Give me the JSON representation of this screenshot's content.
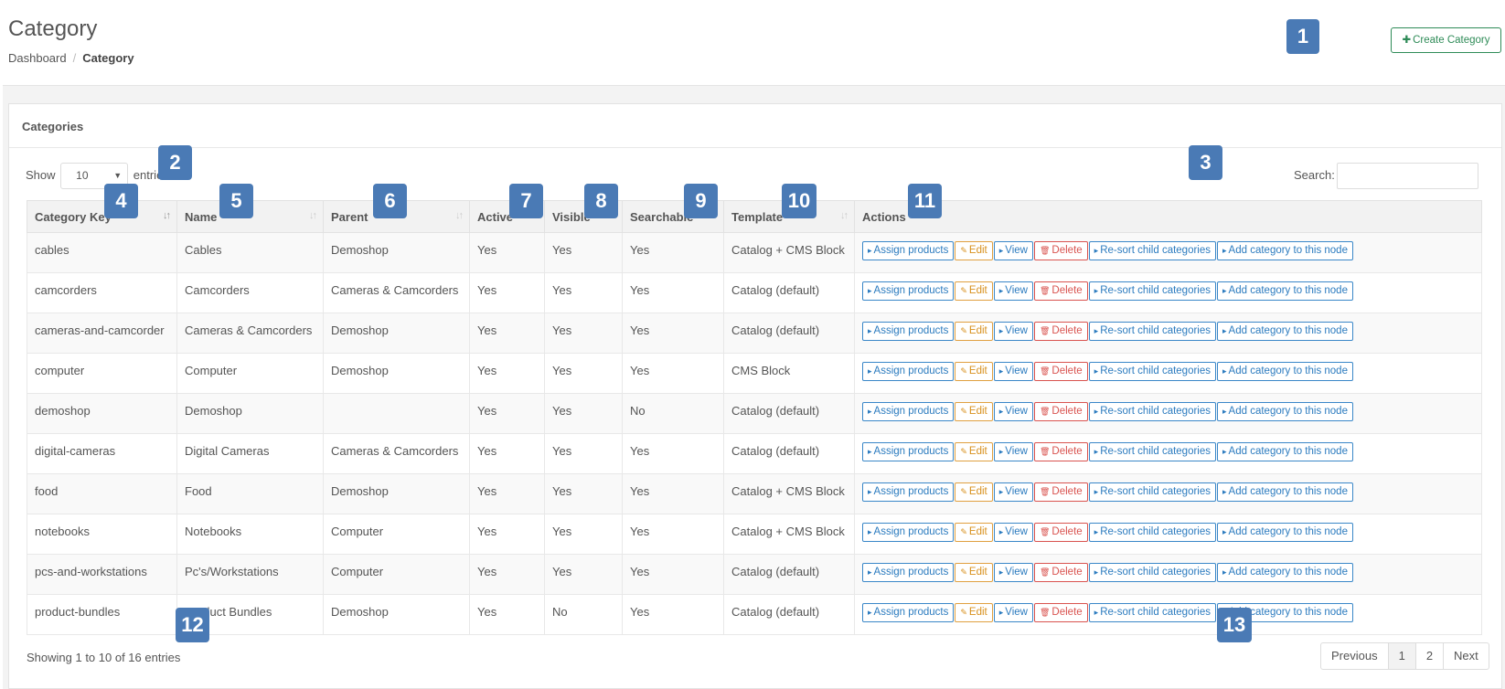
{
  "page": {
    "title": "Category",
    "breadcrumb": [
      "Dashboard",
      "Category"
    ],
    "create_button": "Create Category"
  },
  "panel": {
    "heading": "Categories",
    "show_label": "Show",
    "entries_label": "entries",
    "page_size": "10",
    "search_label": "Search:",
    "search_value": ""
  },
  "table": {
    "columns": [
      "Category Key",
      "Name",
      "Parent",
      "Active",
      "Visible",
      "Searchable",
      "Template",
      "Actions"
    ],
    "rows": [
      [
        "cables",
        "Cables",
        "Demoshop",
        "Yes",
        "Yes",
        "Yes",
        "Catalog + CMS Block"
      ],
      [
        "camcorders",
        "Camcorders",
        "Cameras & Camcorders",
        "Yes",
        "Yes",
        "Yes",
        "Catalog (default)"
      ],
      [
        "cameras-and-camcorder",
        "Cameras & Camcorders",
        "Demoshop",
        "Yes",
        "Yes",
        "Yes",
        "Catalog (default)"
      ],
      [
        "computer",
        "Computer",
        "Demoshop",
        "Yes",
        "Yes",
        "Yes",
        "CMS Block"
      ],
      [
        "demoshop",
        "Demoshop",
        "",
        "Yes",
        "Yes",
        "No",
        "Catalog (default)"
      ],
      [
        "digital-cameras",
        "Digital Cameras",
        "Cameras & Camcorders",
        "Yes",
        "Yes",
        "Yes",
        "Catalog (default)"
      ],
      [
        "food",
        "Food",
        "Demoshop",
        "Yes",
        "Yes",
        "Yes",
        "Catalog + CMS Block"
      ],
      [
        "notebooks",
        "Notebooks",
        "Computer",
        "Yes",
        "Yes",
        "Yes",
        "Catalog + CMS Block"
      ],
      [
        "pcs-and-workstations",
        "Pc's/Workstations",
        "Computer",
        "Yes",
        "Yes",
        "Yes",
        "Catalog (default)"
      ],
      [
        "product-bundles",
        "Product Bundles",
        "Demoshop",
        "Yes",
        "No",
        "Yes",
        "Catalog (default)"
      ]
    ],
    "actions": [
      "Assign products",
      "Edit",
      "View",
      "Delete",
      "Re-sort child categories",
      "Add category to this node"
    ]
  },
  "footer": {
    "info": "Showing 1 to 10 of 16 entries",
    "pagination": [
      "Previous",
      "1",
      "2",
      "Next"
    ]
  },
  "badges": [
    "1",
    "2",
    "3",
    "4",
    "5",
    "6",
    "7",
    "8",
    "9",
    "10",
    "11",
    "12",
    "13"
  ],
  "colors": {
    "badge": "#4a7ab5",
    "create_button": "#2e8b57",
    "action_primary": "#2b7bbf",
    "action_edit": "#d8901c",
    "action_delete": "#d9534f"
  }
}
